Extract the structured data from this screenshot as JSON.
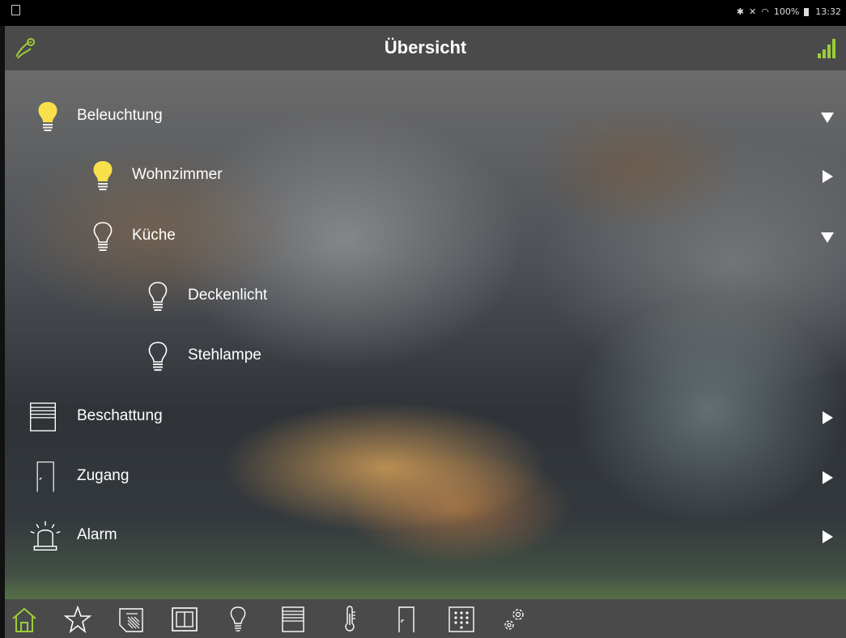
{
  "statusbar": {
    "battery": "100%",
    "time": "13:32"
  },
  "header": {
    "title": "Übersicht"
  },
  "menu": [
    {
      "label": "Beleuchtung",
      "level": 0,
      "icon": "lightbulb-on-icon",
      "expanded": true
    },
    {
      "label": "Wohnzimmer",
      "level": 1,
      "icon": "lightbulb-on-icon",
      "expanded": false
    },
    {
      "label": "Küche",
      "level": 1,
      "icon": "lightbulb-off-icon",
      "expanded": true
    },
    {
      "label": "Deckenlicht",
      "level": 2,
      "icon": "lightbulb-off-icon"
    },
    {
      "label": "Stehlampe",
      "level": 2,
      "icon": "lightbulb-off-icon"
    },
    {
      "label": "Beschattung",
      "level": 0,
      "icon": "blinds-icon",
      "expanded": false
    },
    {
      "label": "Zugang",
      "level": 0,
      "icon": "door-icon",
      "expanded": false
    },
    {
      "label": "Alarm",
      "level": 0,
      "icon": "alarm-siren-icon",
      "expanded": false
    }
  ],
  "tabbar": {
    "items": [
      "home-icon",
      "favorites-star-icon",
      "scenes-icon",
      "window-icon",
      "lightbulb-icon",
      "blinds-icon",
      "thermometer-icon",
      "door-icon",
      "keypad-icon",
      "settings-gears-icon"
    ],
    "active": "home-icon"
  },
  "colors": {
    "accent": "#9ccc3a",
    "bar": "#4a4a4a",
    "bulb_on": "#f7e04a"
  }
}
